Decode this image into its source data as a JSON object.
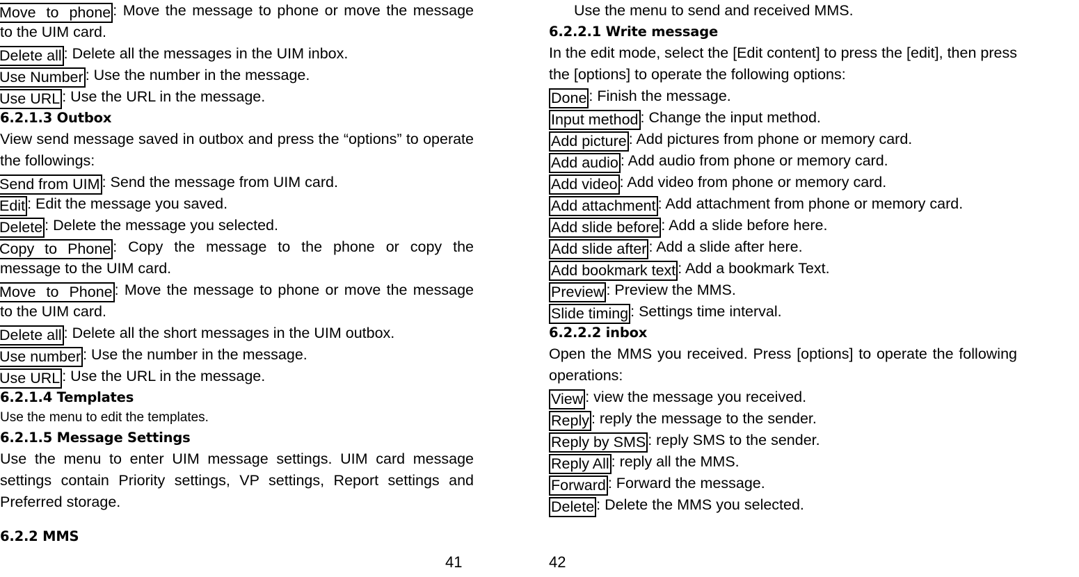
{
  "document": {
    "type": "phone-user-manual",
    "layout": "two-page-spread",
    "pages": [
      "41",
      "42"
    ]
  },
  "left_page": {
    "page_number": "41",
    "lines": [
      {
        "label": "Move  to  phone",
        "text": ": Move the message to phone or move the message to the UIM card."
      },
      {
        "label": "Delete all",
        "text": ": Delete all the messages in the UIM inbox."
      },
      {
        "label": "Use Number",
        "text": ": Use the number in the message."
      },
      {
        "label": "Use URL",
        "text": ": Use the URL in the message."
      }
    ],
    "heading_outbox": "6.2.1.3 Outbox",
    "outbox_intro": "View send message saved in outbox and press the “options” to operate the followings:",
    "outbox_items": [
      {
        "label": "Send from UIM",
        "text": ": Send the message from UIM card."
      },
      {
        "label": "Edit",
        "text": ": Edit the message you saved."
      },
      {
        "label": "Delete",
        "text": ": Delete the message you selected."
      },
      {
        "label": "Copy  to  Phone",
        "text": ": Copy the message to the phone or copy the message to the UIM card."
      },
      {
        "label": "Move  to  Phone",
        "text": ": Move the message to phone or move the message to the UIM card."
      },
      {
        "label": "Delete all",
        "text": ": Delete all the short messages in the UIM outbox."
      },
      {
        "label": "Use number",
        "text": ": Use the number in the message."
      },
      {
        "label": "Use URL",
        "text": ": Use the URL in the message."
      }
    ],
    "heading_templates": "6.2.1.4 Templates",
    "templates_text": "Use the menu to edit the templates.",
    "heading_message_settings": "6.2.1.5 Message Settings",
    "message_settings_text": "Use the menu to enter UIM message settings. UIM card message settings contain Priority settings, VP settings, Report settings and Preferred storage.",
    "heading_mms": "6.2.2 MMS"
  },
  "right_page": {
    "page_number": "42",
    "mms_intro": "Use the menu to send and received MMS.",
    "heading_write_message": "6.2.2.1 Write message",
    "write_message_intro": "In the edit mode, select the [Edit content] to press the [edit], then press the [options] to operate the following options:",
    "write_message_items": [
      {
        "label": "Done",
        "text": ": Finish the message."
      },
      {
        "label": "Input method",
        "text": ": Change the input method."
      },
      {
        "label": "Add picture",
        "text": ": Add pictures from phone or memory card."
      },
      {
        "label": "Add audio",
        "text": ": Add audio from phone or memory card."
      },
      {
        "label": "Add video",
        "text": ": Add video from phone or memory card."
      },
      {
        "label": "Add attachment",
        "text": ": Add attachment from phone or memory card."
      },
      {
        "label": "Add slide before",
        "text": ": Add a slide before here."
      },
      {
        "label": "Add slide after",
        "text": ": Add a slide after here."
      },
      {
        "label": "Add bookmark text",
        "text": ": Add a bookmark Text."
      },
      {
        "label": "Preview",
        "text": ": Preview the MMS."
      },
      {
        "label": "Slide timing",
        "text": ": Settings time interval."
      }
    ],
    "heading_inbox": "6.2.2.2 inbox",
    "inbox_intro": "Open the MMS you received. Press [options] to operate the following operations:",
    "inbox_items": [
      {
        "label": "View",
        "text": ": view the message you received."
      },
      {
        "label": "Reply",
        "text": ": reply the message to the sender."
      },
      {
        "label": "Reply by SMS",
        "text": ": reply SMS to the sender."
      },
      {
        "label": "Reply All",
        "text": ": reply all the MMS."
      },
      {
        "label": "Forward",
        "text": ": Forward the message."
      },
      {
        "label": "Delete",
        "text": ": Delete the MMS you selected."
      }
    ]
  },
  "colors": {
    "page_background": "#ffffff",
    "text": "#000000",
    "label_border": "#000000"
  }
}
